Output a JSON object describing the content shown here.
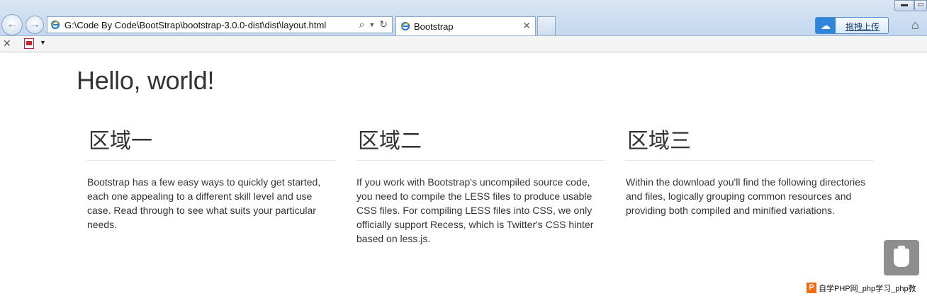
{
  "browser": {
    "address": "G:\\Code By Code\\BootStrap\\bootstrap-3.0.0-dist\\dist\\layout.html",
    "tab_title": "Bootstrap",
    "upload_label": "拖拽上传"
  },
  "page": {
    "hero": "Hello, world!",
    "columns": [
      {
        "heading": "区域一",
        "text": "Bootstrap has a few easy ways to quickly get started, each one appealing to a different skill level and use case. Read through to see what suits your particular needs."
      },
      {
        "heading": "区域二",
        "text": "If you work with Bootstrap's uncompiled source code, you need to compile the LESS files to produce usable CSS files. For compiling LESS files into CSS, we only officially support Recess, which is Twitter's CSS hinter based on less.js."
      },
      {
        "heading": "区域三",
        "text": "Within the download you'll find the following directories and files, logically grouping common resources and providing both compiled and minified variations."
      }
    ]
  },
  "watermark": {
    "logo": "P",
    "text": "自学PHP网_php学习_php教"
  },
  "colors": {
    "accent": "#2f86d8",
    "text": "#333333",
    "watermark_logo": "#f26b11"
  },
  "icons": [
    "back-icon",
    "forward-icon",
    "ie-icon",
    "search-icon",
    "refresh-icon",
    "close-icon",
    "cloud-upload-icon",
    "home-icon",
    "pdf-icon",
    "usb-icon"
  ]
}
